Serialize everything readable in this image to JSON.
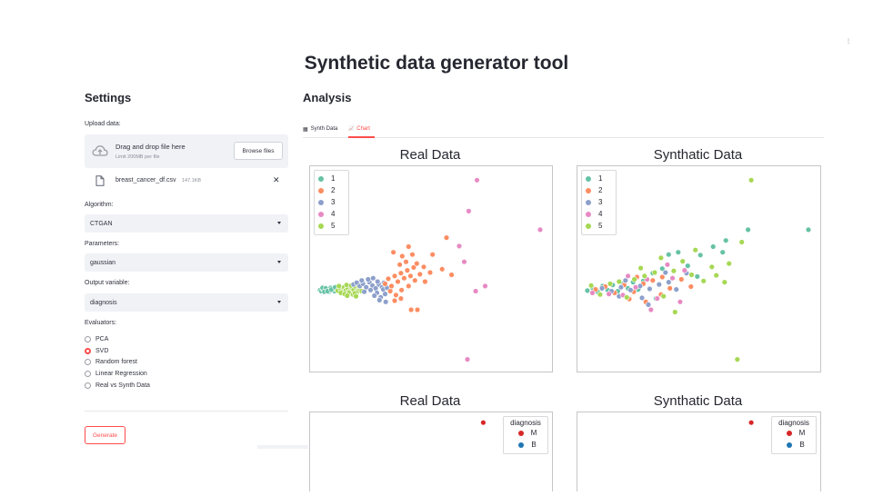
{
  "app": {
    "title": "Synthetic data generator tool",
    "menu_glyph": "⋮"
  },
  "sidebar": {
    "heading": "Settings",
    "upload": {
      "label": "Upload data:",
      "drop_text": "Drag and drop file here",
      "limit_text": "Limit 200MB per file",
      "browse_label": "Browse files",
      "file_name": "breast_cancer_df.csv",
      "file_size": "147.1KB",
      "remove_glyph": "✕"
    },
    "algorithm": {
      "label": "Algorithm:",
      "value": "CTGAN"
    },
    "parameters": {
      "label": "Parameters:",
      "value": "gaussian"
    },
    "output_variable": {
      "label": "Output variable:",
      "value": "diagnosis"
    },
    "evaluators": {
      "label": "Evaluators:",
      "options": [
        "PCA",
        "SVD",
        "Random forest",
        "Linear Regression",
        "Real vs Synth Data"
      ],
      "selected": "SVD"
    },
    "generate_label": "Generate"
  },
  "main": {
    "heading": "Analysis",
    "tabs": [
      {
        "label": "Synth Data",
        "icon": "table-icon",
        "glyph": "▦"
      },
      {
        "label": "Chart",
        "icon": "chart-icon",
        "glyph": "📈"
      }
    ],
    "active_tab": "Chart"
  },
  "colors": {
    "accent": "#ff4b4b",
    "cluster_1": "#66c2a5",
    "cluster_2": "#fc8d62",
    "cluster_3": "#8da0cb",
    "cluster_4": "#e78ac3",
    "cluster_5": "#a6d854",
    "diag_M": "#d62728",
    "diag_B": "#1f77b4"
  },
  "chart_data": [
    {
      "type": "scatter",
      "title": "Real Data",
      "legend": {
        "position": "top-left",
        "entries": [
          "1",
          "2",
          "3",
          "4",
          "5"
        ]
      },
      "axes": "hidden",
      "series": [
        {
          "name": "1",
          "points": [
            [
              0.2,
              0.5
            ],
            [
              0.4,
              0.3
            ],
            [
              0.7,
              0.6
            ],
            [
              1.0,
              0.4
            ],
            [
              1.3,
              0.7
            ],
            [
              1.6,
              0.2
            ],
            [
              1.9,
              0.9
            ],
            [
              2.2,
              0.5
            ],
            [
              2.5,
              0.3
            ],
            [
              2.8,
              0.8
            ],
            [
              0.6,
              0.9
            ],
            [
              1.1,
              0.8
            ],
            [
              1.8,
              0.4
            ],
            [
              2.4,
              0.7
            ],
            [
              3.0,
              0.5
            ],
            [
              0.9,
              0.2
            ],
            [
              1.4,
              0.3
            ],
            [
              2.0,
              0.6
            ],
            [
              2.6,
              1.0
            ],
            [
              3.2,
              0.7
            ]
          ]
        },
        {
          "name": "5",
          "points": [
            [
              3.0,
              0.4
            ],
            [
              3.4,
              0.8
            ],
            [
              3.7,
              0.2
            ],
            [
              4.0,
              1.0
            ],
            [
              4.3,
              0.5
            ],
            [
              4.6,
              0.8
            ],
            [
              4.9,
              0.3
            ],
            [
              5.2,
              0.9
            ],
            [
              5.5,
              0.6
            ],
            [
              5.8,
              1.1
            ],
            [
              6.1,
              0.4
            ],
            [
              3.5,
              0.0
            ],
            [
              4.1,
              -0.2
            ],
            [
              4.8,
              0.0
            ],
            [
              5.4,
              -0.3
            ],
            [
              6.0,
              0.1
            ],
            [
              6.5,
              0.7
            ],
            [
              3.2,
              1.2
            ],
            [
              4.4,
              1.4
            ],
            [
              5.1,
              1.3
            ],
            [
              5.7,
              -0.1
            ],
            [
              6.3,
              1.2
            ],
            [
              6.8,
              0.3
            ],
            [
              4.5,
              -0.5
            ],
            [
              5.9,
              -0.6
            ]
          ]
        },
        {
          "name": "3",
          "points": [
            [
              5.5,
              1.5
            ],
            [
              6.0,
              1.8
            ],
            [
              6.5,
              1.2
            ],
            [
              7.0,
              1.6
            ],
            [
              7.5,
              1.0
            ],
            [
              8.0,
              1.9
            ],
            [
              8.5,
              1.3
            ],
            [
              9.0,
              0.8
            ],
            [
              9.5,
              1.5
            ],
            [
              10.0,
              1.0
            ],
            [
              7.2,
              0.2
            ],
            [
              8.2,
              0.5
            ],
            [
              9.2,
              0.0
            ],
            [
              10.2,
              0.6
            ],
            [
              8.8,
              -0.5
            ],
            [
              9.8,
              -0.8
            ],
            [
              10.5,
              -0.2
            ],
            [
              6.8,
              2.2
            ],
            [
              7.8,
              2.4
            ],
            [
              9.3,
              2.0
            ],
            [
              10.3,
              1.8
            ],
            [
              8.6,
              2.6
            ],
            [
              10.8,
              0.9
            ],
            [
              9.6,
              -1.3
            ],
            [
              10.6,
              -1.6
            ]
          ]
        },
        {
          "name": "2",
          "points": [
            [
              10.5,
              1.6
            ],
            [
              11.0,
              2.5
            ],
            [
              11.5,
              1.2
            ],
            [
              12.0,
              3.0
            ],
            [
              12.5,
              2.0
            ],
            [
              13.0,
              3.5
            ],
            [
              13.5,
              2.6
            ],
            [
              14.0,
              4.0
            ],
            [
              14.5,
              3.0
            ],
            [
              15.0,
              4.5
            ],
            [
              11.3,
              0.3
            ],
            [
              12.2,
              -0.4
            ],
            [
              13.1,
              0.5
            ],
            [
              14.2,
              1.2
            ],
            [
              15.2,
              2.2
            ],
            [
              16.0,
              3.3
            ],
            [
              12.8,
              5.0
            ],
            [
              13.8,
              5.5
            ],
            [
              15.5,
              5.2
            ],
            [
              13.2,
              6.5
            ],
            [
              14.8,
              6.8
            ],
            [
              16.6,
              4.6
            ],
            [
              12.0,
              -1.4
            ],
            [
              14.6,
              -3.0
            ],
            [
              15.6,
              -3.0
            ],
            [
              13.0,
              -1.0
            ],
            [
              16.8,
              2.0
            ],
            [
              17.6,
              3.6
            ],
            [
              19.5,
              4.2
            ],
            [
              21.0,
              3.2
            ],
            [
              20.2,
              9.8
            ],
            [
              18.0,
              6.8
            ],
            [
              14.2,
              8.2
            ],
            [
              11.8,
              7.2
            ]
          ]
        },
        {
          "name": "4",
          "points": [
            [
              25.0,
              20.0
            ],
            [
              23.7,
              14.5
            ],
            [
              35.0,
              11.2
            ],
            [
              22.2,
              8.3
            ],
            [
              23.0,
              5.5
            ],
            [
              24.8,
              0.3
            ],
            [
              26.3,
              1.2
            ],
            [
              23.5,
              -11.8
            ]
          ]
        }
      ]
    },
    {
      "type": "scatter",
      "title": "Synthatic Data",
      "legend": {
        "position": "top-left",
        "entries": [
          "1",
          "2",
          "3",
          "4",
          "5"
        ]
      },
      "axes": "hidden",
      "series": [
        {
          "name": "1",
          "points": [
            [
              0.2,
              0.4
            ],
            [
              1.0,
              0.9
            ],
            [
              1.8,
              0.2
            ],
            [
              2.6,
              1.2
            ],
            [
              3.4,
              0.5
            ],
            [
              4.2,
              1.4
            ],
            [
              5.0,
              0.3
            ],
            [
              5.8,
              1.6
            ],
            [
              6.6,
              0.8
            ],
            [
              7.4,
              1.9
            ],
            [
              8.2,
              0.6
            ],
            [
              9.0,
              2.1
            ],
            [
              10.5,
              3.5
            ],
            [
              12.0,
              4.3
            ],
            [
              13.0,
              6.8
            ],
            [
              14.5,
              7.2
            ],
            [
              16.0,
              4.8
            ],
            [
              18.0,
              6.7
            ],
            [
              20.0,
              8.2
            ],
            [
              21.5,
              7.2
            ],
            [
              25.5,
              11.2
            ],
            [
              35.0,
              11.2
            ],
            [
              22.0,
              9.3
            ],
            [
              17.5,
              2.9
            ],
            [
              11.0,
              -1.0
            ]
          ]
        },
        {
          "name": "2",
          "points": [
            [
              1.5,
              0.6
            ],
            [
              3.0,
              1.1
            ],
            [
              4.5,
              0.0
            ],
            [
              6.0,
              1.4
            ],
            [
              7.5,
              0.2
            ],
            [
              9.0,
              1.6
            ],
            [
              10.5,
              2.2
            ],
            [
              12.0,
              2.8
            ],
            [
              6.8,
              -1.1
            ],
            [
              9.4,
              -1.6
            ],
            [
              13.2,
              0.8
            ],
            [
              15.0,
              2.4
            ],
            [
              16.5,
              1.1
            ],
            [
              8.0,
              2.8
            ],
            [
              11.8,
              -0.3
            ]
          ]
        },
        {
          "name": "3",
          "points": [
            [
              2.5,
              0.8
            ],
            [
              4.0,
              0.3
            ],
            [
              5.5,
              1.0
            ],
            [
              7.0,
              0.5
            ],
            [
              8.5,
              1.2
            ],
            [
              10.0,
              0.7
            ],
            [
              11.5,
              1.5
            ],
            [
              13.0,
              1.9
            ],
            [
              5.2,
              -0.6
            ],
            [
              8.8,
              -0.9
            ],
            [
              12.5,
              3.6
            ],
            [
              14.2,
              0.6
            ],
            [
              9.8,
              -2.1
            ],
            [
              6.2,
              2.2
            ],
            [
              15.8,
              3.5
            ]
          ]
        },
        {
          "name": "4",
          "points": [
            [
              1.0,
              0.0
            ],
            [
              3.6,
              -0.2
            ],
            [
              5.8,
              -0.4
            ],
            [
              7.8,
              1.0
            ],
            [
              9.6,
              2.4
            ],
            [
              11.2,
              -1.0
            ],
            [
              13.6,
              2.6
            ],
            [
              15.5,
              4.0
            ],
            [
              10.2,
              -3.0
            ],
            [
              14.8,
              -1.6
            ],
            [
              12.8,
              5.0
            ],
            [
              6.6,
              3.0
            ]
          ]
        },
        {
          "name": "5",
          "points": [
            [
              0.8,
              1.3
            ],
            [
              2.2,
              -0.3
            ],
            [
              3.8,
              1.6
            ],
            [
              5.2,
              2.0
            ],
            [
              6.4,
              -0.8
            ],
            [
              7.6,
              2.4
            ],
            [
              9.2,
              3.0
            ],
            [
              10.8,
              3.6
            ],
            [
              12.2,
              -0.6
            ],
            [
              13.8,
              3.9
            ],
            [
              15.2,
              5.6
            ],
            [
              16.6,
              3.2
            ],
            [
              18.5,
              2.1
            ],
            [
              20.5,
              3.1
            ],
            [
              22.5,
              5.2
            ],
            [
              24.5,
              9.0
            ],
            [
              26.0,
              20.0
            ],
            [
              23.8,
              -11.8
            ],
            [
              19.8,
              4.6
            ],
            [
              14.0,
              -3.4
            ],
            [
              11.8,
              6.2
            ],
            [
              8.6,
              4.4
            ],
            [
              17.2,
              7.6
            ],
            [
              21.8,
              1.9
            ]
          ]
        }
      ]
    },
    {
      "type": "scatter",
      "title": "Real Data",
      "legend": {
        "title": "diagnosis",
        "position": "top-right",
        "entries": [
          "M",
          "B"
        ]
      },
      "axes": "hidden",
      "series": [
        {
          "name": "M",
          "points": [
            [
              26.0,
              20.0
            ]
          ]
        }
      ]
    },
    {
      "type": "scatter",
      "title": "Synthatic Data",
      "legend": {
        "title": "diagnosis",
        "position": "top-right",
        "entries": [
          "M",
          "B"
        ]
      },
      "axes": "hidden",
      "series": [
        {
          "name": "M",
          "points": [
            [
              26.0,
              20.0
            ]
          ]
        }
      ]
    }
  ]
}
